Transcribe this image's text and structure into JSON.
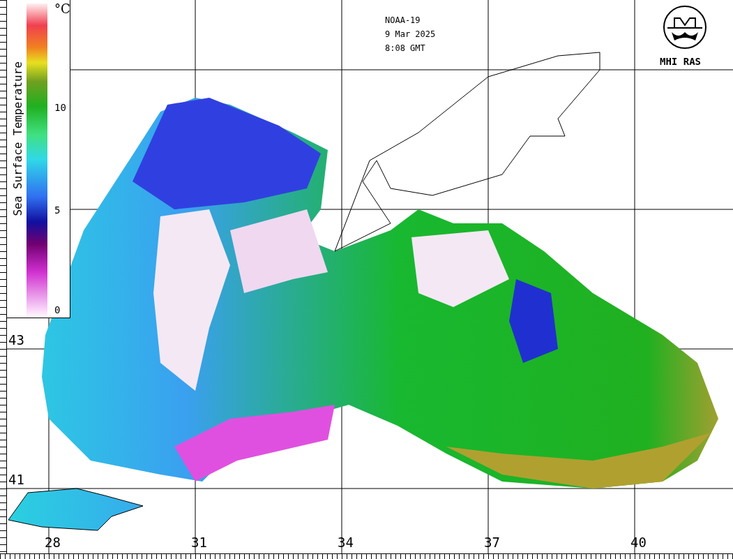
{
  "header": {
    "satellite": "NOAA-19",
    "date": "9 Mar 2025",
    "time": "8:08 GMT"
  },
  "logo": {
    "caption": "MHI RAS"
  },
  "legend": {
    "title": "Sea Surface Temperature",
    "unit": "°C",
    "ticks": [
      "10",
      "5",
      "0"
    ]
  },
  "latitudes": [
    "43",
    "41"
  ],
  "longitudes": [
    "28",
    "31",
    "34",
    "37",
    "40"
  ]
}
